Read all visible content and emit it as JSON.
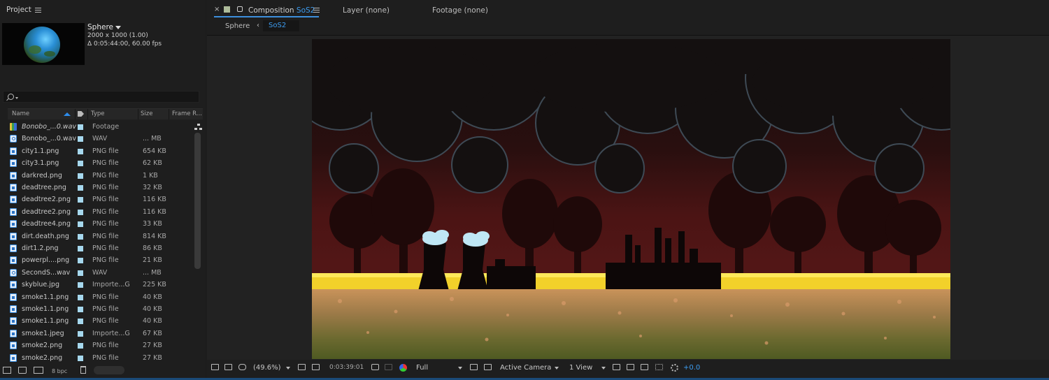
{
  "project": {
    "title": "Project",
    "item_name": "Sphere",
    "item_dims": "2000 x 1000 (1.00)",
    "item_duration": "Δ 0:05:44:00, 60.00 fps",
    "columns": {
      "name": "Name",
      "type": "Type",
      "size": "Size",
      "frame_rate": "Frame R..."
    },
    "files": [
      {
        "name": "Bonobo_...0.wav",
        "type": "Footage",
        "size": "",
        "icon": "footage-icon",
        "italic": true
      },
      {
        "name": "Bonobo_...0.wav",
        "type": "WAV",
        "size": "... MB",
        "icon": "audio-file-icon"
      },
      {
        "name": "city1.1.png",
        "type": "PNG file",
        "size": "654 KB",
        "icon": "image-file-icon"
      },
      {
        "name": "city3.1.png",
        "type": "PNG file",
        "size": "62 KB",
        "icon": "image-file-icon"
      },
      {
        "name": "darkred.png",
        "type": "PNG file",
        "size": "1 KB",
        "icon": "image-file-icon"
      },
      {
        "name": "deadtree.png",
        "type": "PNG file",
        "size": "32 KB",
        "icon": "image-file-icon"
      },
      {
        "name": "deadtree2.png",
        "type": "PNG file",
        "size": "116 KB",
        "icon": "image-file-icon"
      },
      {
        "name": "deadtree2.png",
        "type": "PNG file",
        "size": "116 KB",
        "icon": "image-file-icon"
      },
      {
        "name": "deadtree4.png",
        "type": "PNG file",
        "size": "33 KB",
        "icon": "image-file-icon"
      },
      {
        "name": "dirt.death.png",
        "type": "PNG file",
        "size": "814 KB",
        "icon": "image-file-icon"
      },
      {
        "name": "dirt1.2.png",
        "type": "PNG file",
        "size": "86 KB",
        "icon": "image-file-icon"
      },
      {
        "name": "powerpl....png",
        "type": "PNG file",
        "size": "21 KB",
        "icon": "image-file-icon"
      },
      {
        "name": "SecondS...wav",
        "type": "WAV",
        "size": "... MB",
        "icon": "audio-file-icon"
      },
      {
        "name": "skyblue.jpg",
        "type": "Importe...G",
        "size": "225 KB",
        "icon": "image-file-icon"
      },
      {
        "name": "smoke1.1.png",
        "type": "PNG file",
        "size": "40 KB",
        "icon": "image-file-icon"
      },
      {
        "name": "smoke1.1.png",
        "type": "PNG file",
        "size": "40 KB",
        "icon": "image-file-icon"
      },
      {
        "name": "smoke1.1.png",
        "type": "PNG file",
        "size": "40 KB",
        "icon": "image-file-icon"
      },
      {
        "name": "smoke1.jpeg",
        "type": "Importe...G",
        "size": "67 KB",
        "icon": "image-file-icon"
      },
      {
        "name": "smoke2.png",
        "type": "PNG file",
        "size": "27 KB",
        "icon": "image-file-icon"
      },
      {
        "name": "smoke2.png",
        "type": "PNG file",
        "size": "27 KB",
        "icon": "image-file-icon"
      }
    ],
    "footer": {
      "bpc": "8 bpc"
    }
  },
  "composition": {
    "tab_prefix": "Composition",
    "tab_name": "SoS2",
    "layer_tab": "Layer (none)",
    "footage_tab": "Footage (none)",
    "breadcrumb": {
      "parent": "Sphere",
      "current": "SoS2"
    }
  },
  "viewer_footer": {
    "zoom": "(49.6%)",
    "timecode": "0:03:39:01",
    "resolution": "Full",
    "camera": "Active Camera",
    "views": "1 View",
    "exposure": "+0.0"
  },
  "colors": {
    "accent": "#3d9cf0",
    "label_aqua": "#a6d8ee",
    "panel_bg": "#1e1e1e",
    "sky_dark_red": "#521616",
    "lava_yellow": "#f2d12a",
    "smoke_cyan": "#bfe6f4"
  }
}
